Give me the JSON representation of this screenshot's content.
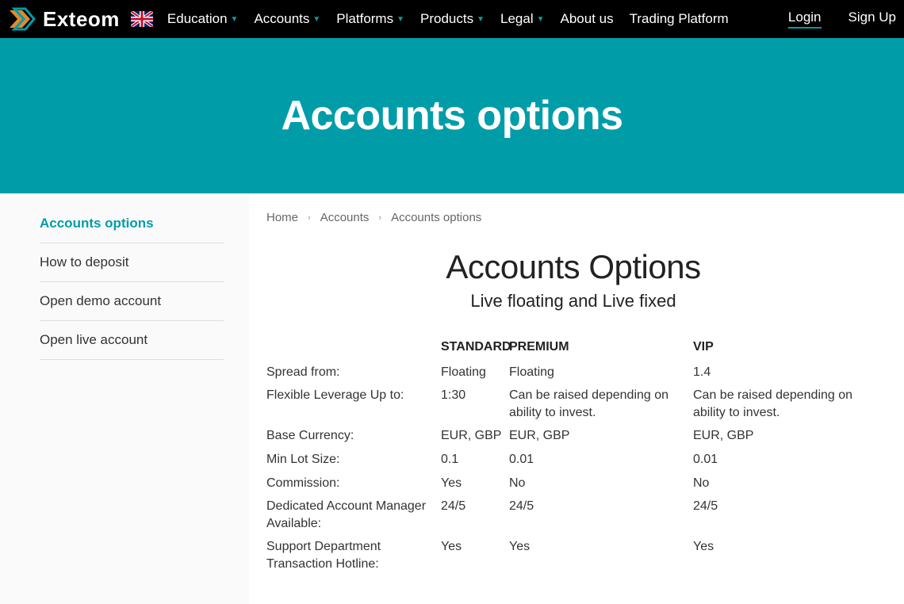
{
  "brand": "Exteom",
  "nav": {
    "items": [
      {
        "label": "Education",
        "dropdown": true
      },
      {
        "label": "Accounts",
        "dropdown": true
      },
      {
        "label": "Platforms",
        "dropdown": true
      },
      {
        "label": "Products",
        "dropdown": true
      },
      {
        "label": "Legal",
        "dropdown": true
      },
      {
        "label": "About us",
        "dropdown": false
      },
      {
        "label": "Trading Platform",
        "dropdown": false
      }
    ],
    "login": "Login",
    "signup": "Sign Up"
  },
  "hero": {
    "title": "Accounts options"
  },
  "sidebar": {
    "items": [
      {
        "label": "Accounts options",
        "active": true
      },
      {
        "label": "How to deposit",
        "active": false
      },
      {
        "label": "Open demo account",
        "active": false
      },
      {
        "label": "Open live account",
        "active": false
      }
    ]
  },
  "breadcrumb": [
    "Home",
    "Accounts",
    "Accounts options"
  ],
  "content": {
    "heading": "Accounts Options",
    "sub": "Live floating and Live fixed"
  },
  "table": {
    "headers": [
      "",
      "STANDARD",
      "PREMIUM",
      "VIP"
    ],
    "rows": [
      {
        "label": "Spread from:",
        "std": "Floating",
        "prem": "Floating",
        "vip": "1.4"
      },
      {
        "label": "Flexible Leverage Up to:",
        "std": "1:30",
        "prem": "Can be raised depending on ability to invest.",
        "vip": "Can be raised depending on ability to invest."
      },
      {
        "label": "Base Currency:",
        "std": "EUR, GBP",
        "prem": "EUR, GBP",
        "vip": "EUR, GBP"
      },
      {
        "label": "Min Lot Size:",
        "std": "0.1",
        "prem": "0.01",
        "vip": "0.01"
      },
      {
        "label": "Commission:",
        "std": "Yes",
        "prem": "No",
        "vip": "No"
      },
      {
        "label": "Dedicated Account Manager Available:",
        "std": "24/5",
        "prem": "24/5",
        "vip": "24/5"
      },
      {
        "label": "Support Department Transaction Hotline:",
        "std": "Yes",
        "prem": "Yes",
        "vip": "Yes"
      }
    ]
  }
}
